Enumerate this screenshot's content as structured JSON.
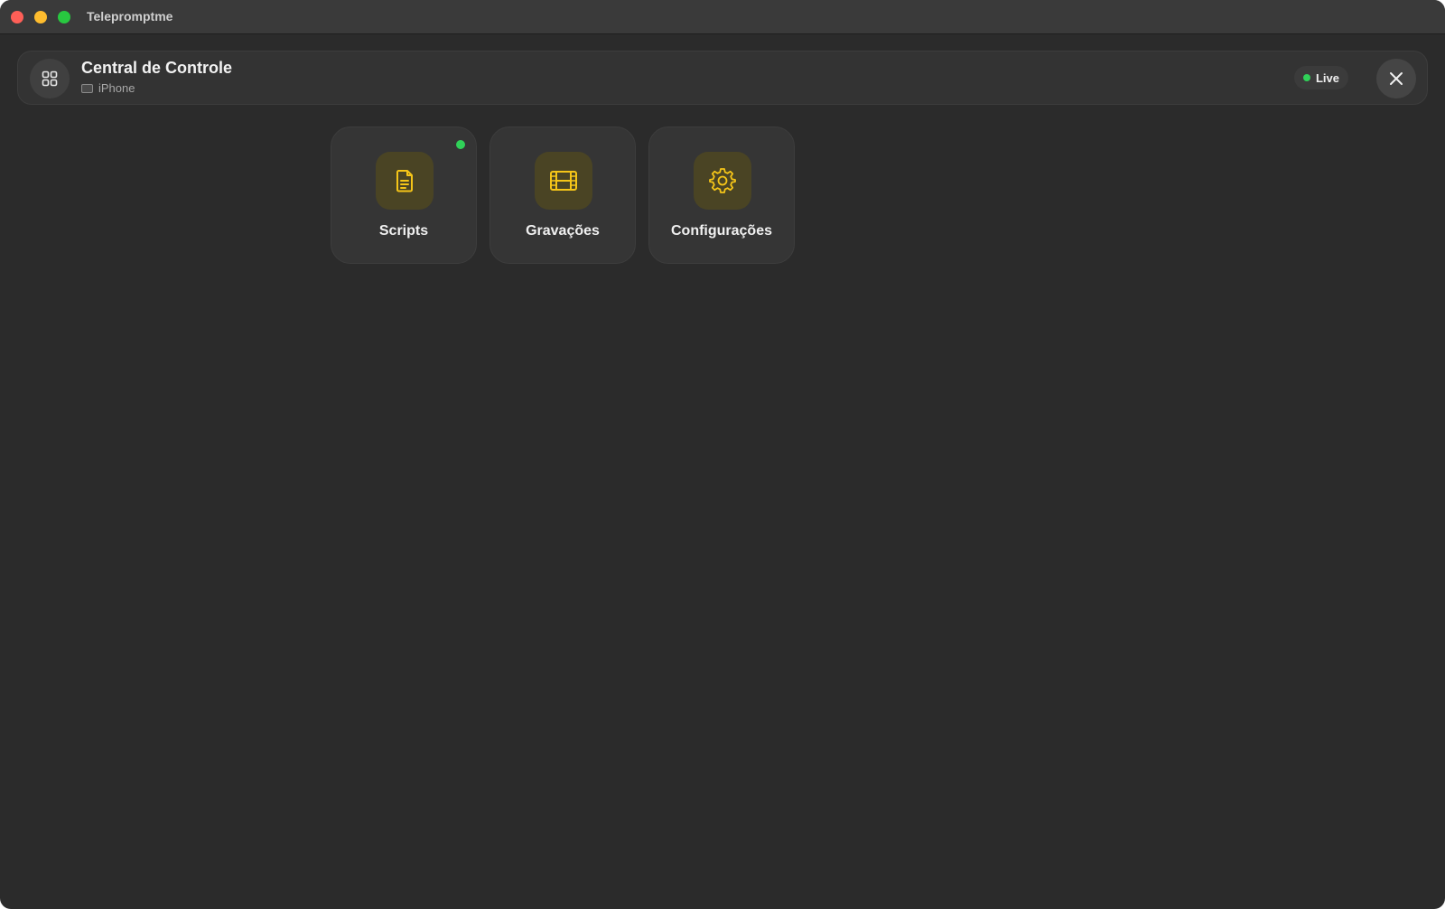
{
  "window": {
    "app_title": "Telepromptme"
  },
  "header": {
    "title": "Central de Controle",
    "device": "iPhone",
    "status": "Live"
  },
  "tiles": [
    {
      "label": "Scripts",
      "icon": "document-icon",
      "has_indicator": true
    },
    {
      "label": "Gravações",
      "icon": "film-icon",
      "has_indicator": false
    },
    {
      "label": "Configurações",
      "icon": "gear-icon",
      "has_indicator": false
    }
  ],
  "colors": {
    "accent": "#f5c518",
    "live": "#30d158",
    "background": "#2b2b2b"
  }
}
